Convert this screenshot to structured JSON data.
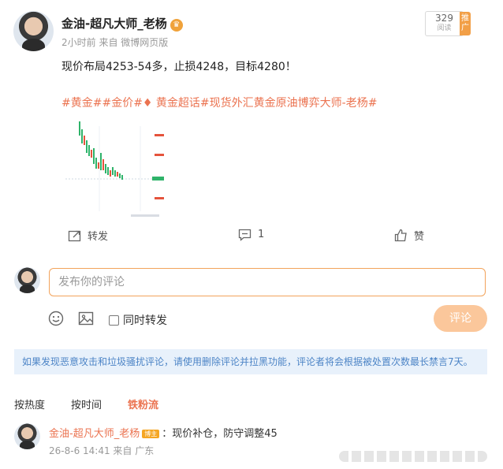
{
  "post": {
    "author": "金油-超凡大师_老杨",
    "meta": "2小时前  来自 微博网页版",
    "read_count": "329",
    "read_label": "阅读",
    "promo_label": "推广",
    "text": "现价布局4253-54多，止损4248，目标4280！",
    "tags": "#黄金##金价#♦ 黄金超话#现货外汇黄金原油博弈大师-老杨#"
  },
  "actions": {
    "repost": "转发",
    "comment_count": "1",
    "like": "赞"
  },
  "composer": {
    "placeholder": "发布你的评论",
    "repost_checkbox": "同时转发",
    "submit": "评论"
  },
  "notice": "如果发现恶意攻击和垃圾骚扰评论，请使用删除评论并拉黑功能，评论者将会根据被处置次数最长禁言7天。",
  "sort": [
    "按热度",
    "按时间",
    "铁粉流"
  ],
  "comment": {
    "author": "金油-超凡大师_老杨",
    "badge": "博主",
    "text": "：现价补仓，防守调整45",
    "meta": "26-8-6 14:41 来自 广东"
  },
  "colors": {
    "accent": "#eb7350",
    "link": "#4c84c6",
    "submit_disabled": "#fbc79b"
  }
}
